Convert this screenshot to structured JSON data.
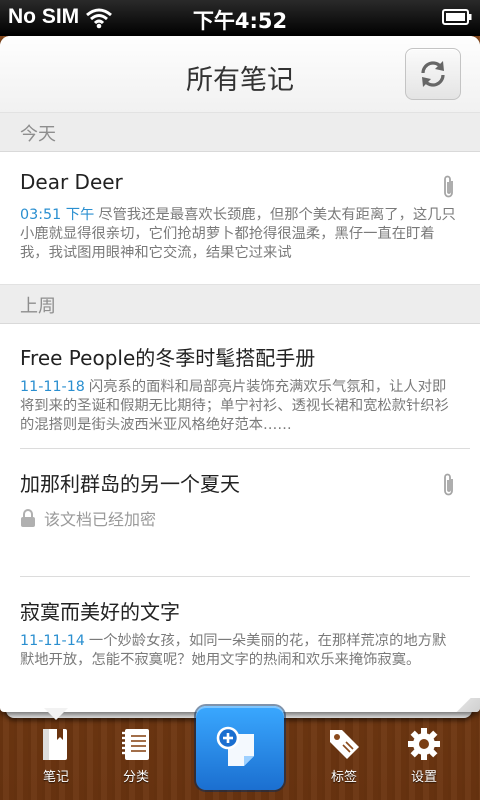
{
  "status_bar": {
    "carrier": "No SIM",
    "time": "下午4:52"
  },
  "header": {
    "title": "所有笔记",
    "sync_icon": "sync-icon"
  },
  "sections": [
    {
      "label": "今天",
      "notes": [
        {
          "title": "Dear Deer",
          "date": "03:51 下午",
          "preview": "尽管我还是最喜欢长颈鹿，但那个美太有距离了，这几只小鹿就显得很亲切，它们抢胡萝卜都抢得很温柔，黑仔一直在盯着我，我试图用眼神和它交流，结果它过来试",
          "has_attachment": true
        }
      ]
    },
    {
      "label": "上周",
      "notes": [
        {
          "title": "Free People的冬季时髦搭配手册",
          "date": "11-11-18",
          "preview": "闪亮系的面料和局部亮片装饰充满欢乐气氛和，让人对即将到来的圣诞和假期无比期待；单宁衬衫、透视长裙和宽松款针织衫的混搭则是街头波西米亚风格绝好范本……",
          "has_attachment": false
        },
        {
          "title": "加那利群岛的另一个夏天",
          "locked_text": "该文档已经加密",
          "has_attachment": true
        },
        {
          "title": "寂寞而美好的文字",
          "date": "11-11-14",
          "preview": "一个妙龄女孩，如同一朵美丽的花，在那样荒凉的地方默默地开放，怎能不寂寞呢？她用文字的热闹和欢乐来掩饰寂寞。",
          "has_attachment": false
        }
      ]
    }
  ],
  "tabbar": {
    "notes": "笔记",
    "categories": "分类",
    "tags": "标签",
    "settings": "设置"
  },
  "colors": {
    "accent": "#2a8fd0",
    "wood": "#7a3e14",
    "compose": "#2a8ef0"
  }
}
